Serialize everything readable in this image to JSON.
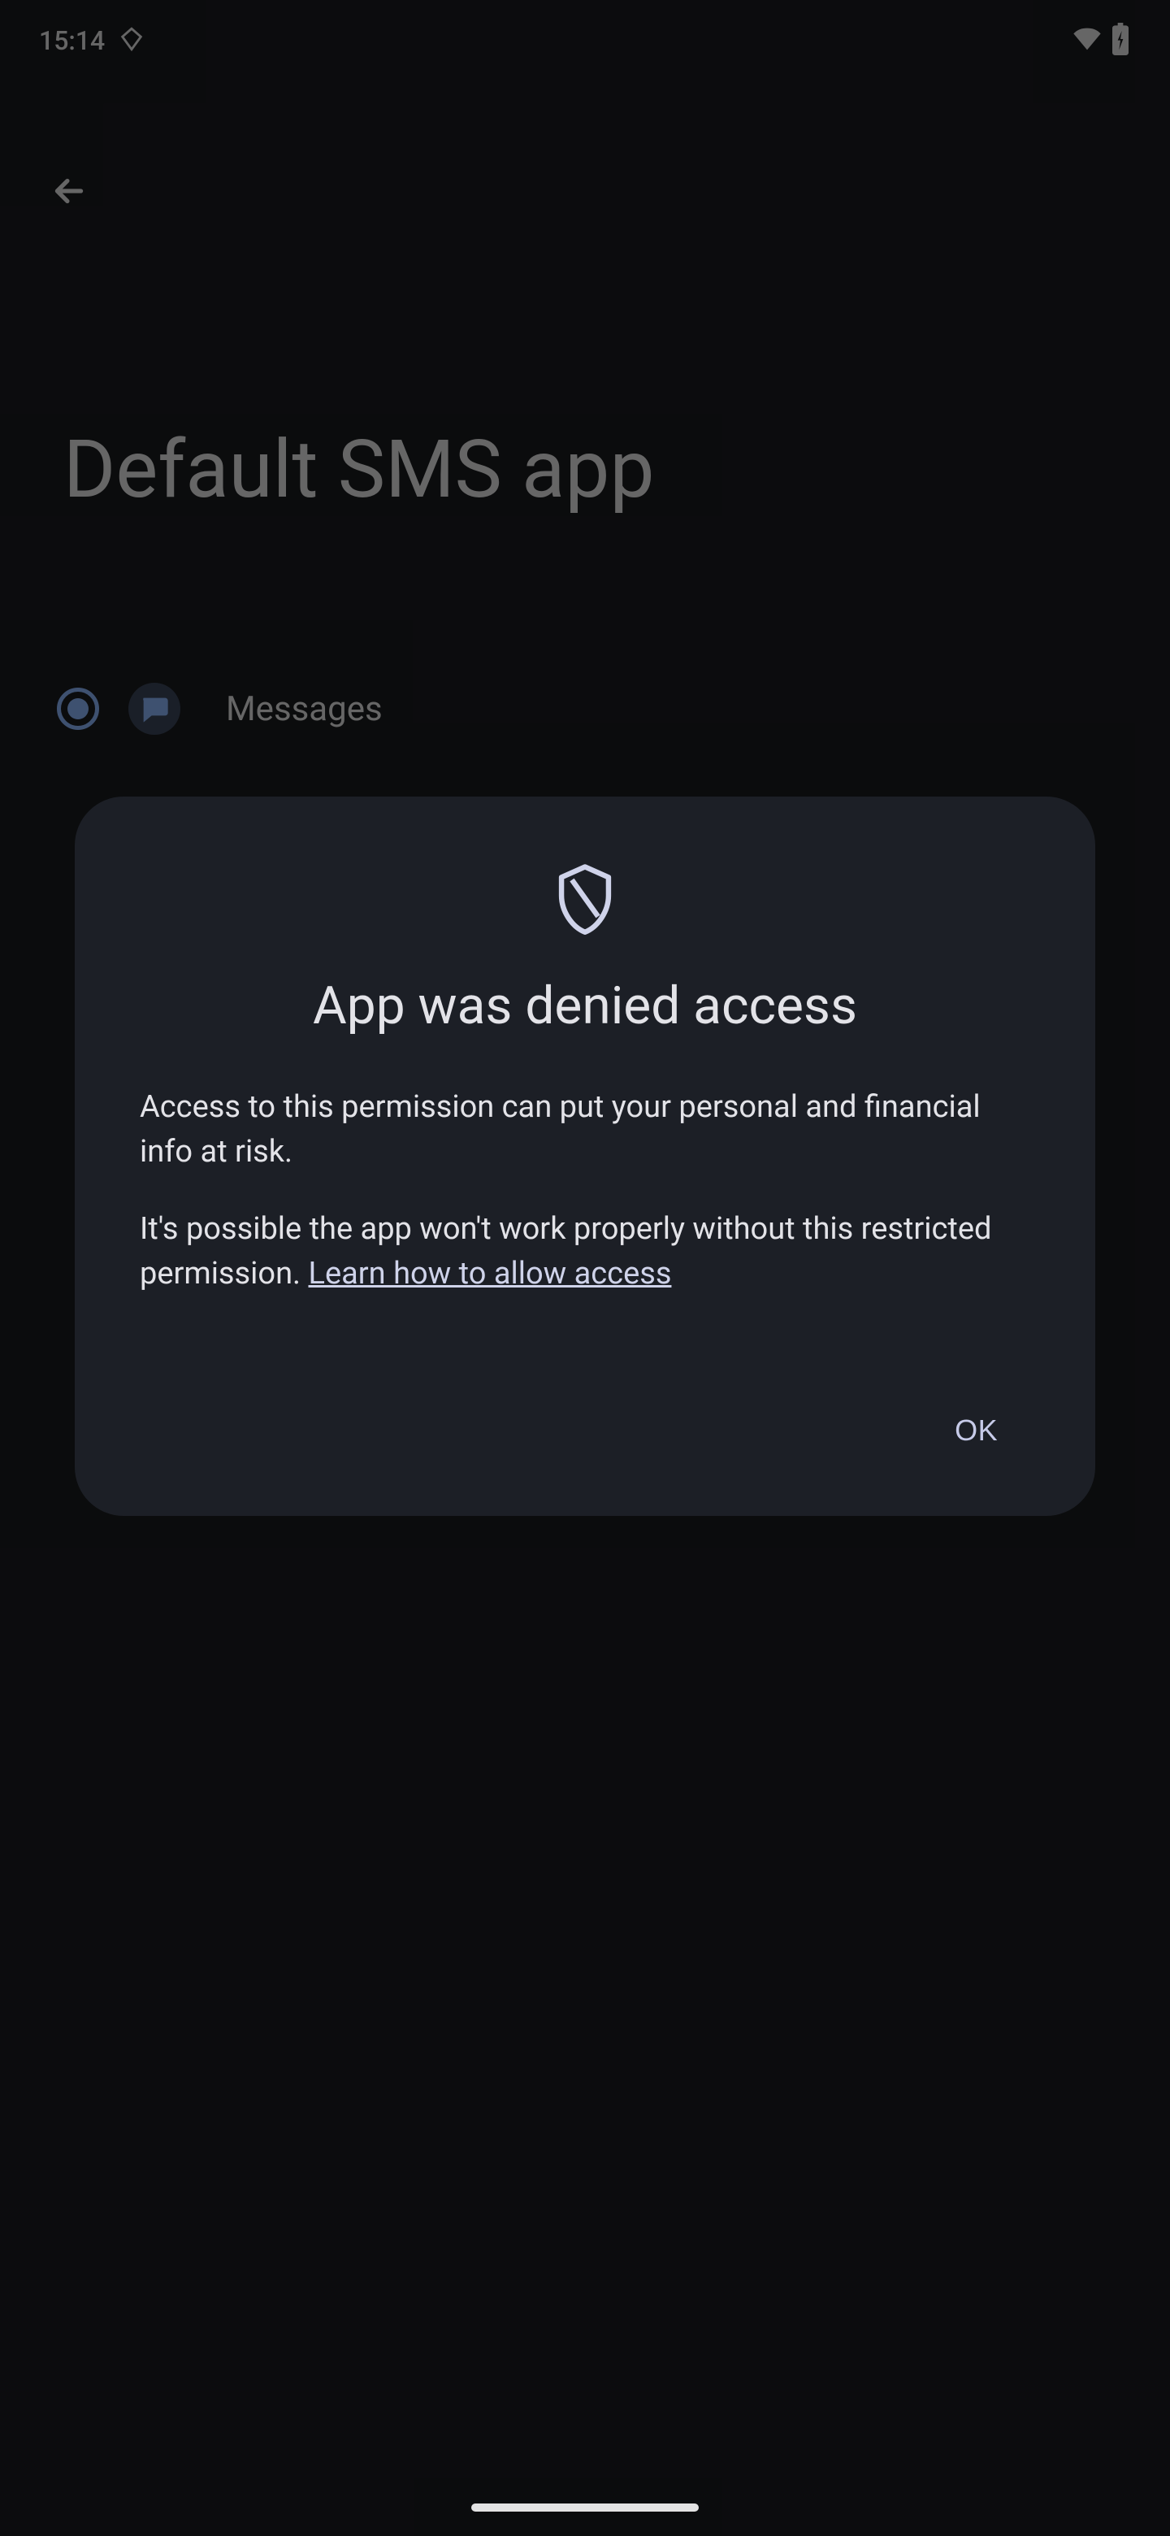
{
  "status_bar": {
    "time": "15:14"
  },
  "background": {
    "page_title": "Default SMS app",
    "selected_app": "Messages"
  },
  "dialog": {
    "title": "App was denied access",
    "body_1": "Access to this permission can put your personal and financial info at risk.",
    "body_2_prefix": "It's possible the app won't work properly without this restricted permission. ",
    "link_text": "Learn how to allow access",
    "ok_label": "OK"
  },
  "colors": {
    "dialog_bg": "#1c1f26",
    "text_primary": "#e3e3e8",
    "accent": "#c6cae8",
    "radio": "#8ab4f8"
  }
}
